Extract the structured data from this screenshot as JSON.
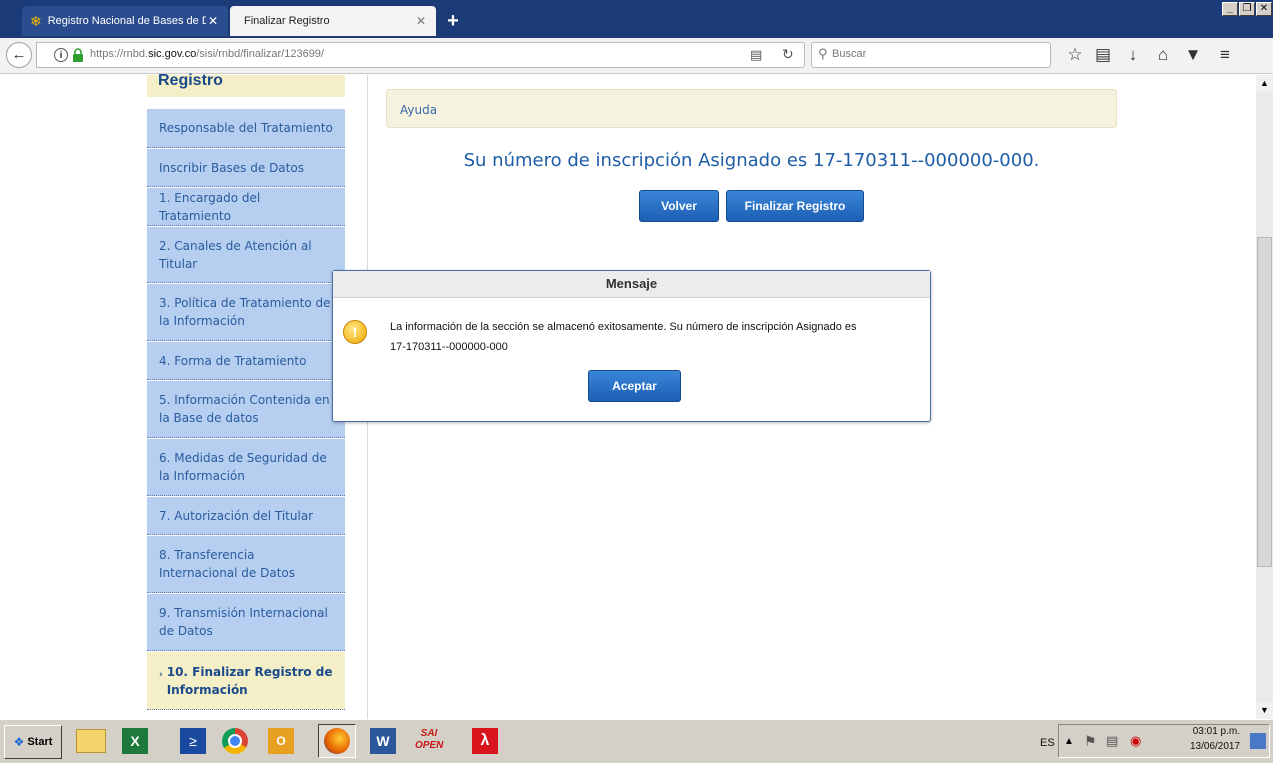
{
  "browser": {
    "tabs": [
      {
        "label": "Registro Nacional de Bases de D",
        "active": false
      },
      {
        "label": "Finalizar Registro",
        "active": true
      }
    ],
    "url_prefix": "https://rnbd.",
    "url_domain": "sic.gov.co",
    "url_path": "/sisi/rnbd/finalizar/123699/",
    "search_placeholder": "Buscar"
  },
  "sidebar": {
    "title": "Registro",
    "items": [
      {
        "label": "Responsable del Tratamiento"
      },
      {
        "label": "Inscribir Bases de Datos"
      },
      {
        "label": "1. Encargado del Tratamiento"
      },
      {
        "label": "2. Canales de Atención al Titular"
      },
      {
        "label": "3. Política de Tratamiento de la Información"
      },
      {
        "label": "4. Forma de Tratamiento"
      },
      {
        "label": "5. Información Contenida en la Base de datos"
      },
      {
        "label": "6. Medidas de Seguridad de la Información"
      },
      {
        "label": "7. Autorización del Titular"
      },
      {
        "label": "8. Transferencia Internacional de Datos"
      },
      {
        "label": "9. Transmisión Internacional de Datos"
      },
      {
        "label": "10. Finalizar Registro de Información",
        "active": true
      }
    ]
  },
  "main": {
    "help_label": "Ayuda",
    "inscription_message": "Su número de inscripción Asignado es 17-170311--000000-000.",
    "volver_label": "Volver",
    "finalizar_label": "Finalizar Registro"
  },
  "dialog": {
    "title": "Mensaje",
    "message_line1": "La información de la sección se almacenó exitosamente. Su número de inscripción Asignado es",
    "message_line2": "17-170311--000000-000",
    "ok_label": "Aceptar"
  },
  "taskbar": {
    "start_label": "Start",
    "language": "ES",
    "time": "03:01 p.m.",
    "date": "13/06/2017"
  },
  "colors": {
    "sidebar_item_bg": "#b6cef0",
    "sidebar_active_bg": "#f5efc8",
    "primary_button": "#1d5fb4",
    "heading_blue": "#1e5da8"
  }
}
